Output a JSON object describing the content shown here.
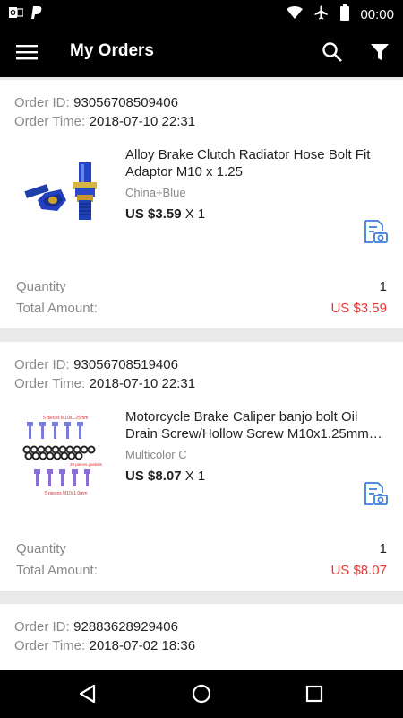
{
  "status_bar": {
    "time": "00:00",
    "left_icons": [
      "outlook-icon",
      "paypal-icon"
    ],
    "right_icons": [
      "wifi-icon",
      "airplane-mode-icon",
      "battery-icon"
    ]
  },
  "app_bar": {
    "title": "My Orders",
    "icons": [
      "menu-icon",
      "search-icon",
      "filter-icon"
    ]
  },
  "labels": {
    "order_id": "Order ID:",
    "order_time": "Order Time:",
    "quantity": "Quantity",
    "total_amount": "Total Amount:"
  },
  "orders": [
    {
      "order_id": "93056708509406",
      "order_time": "2018-07-10 22:31",
      "product_title": "Alloy Brake Clutch Radiator Hose Bolt Fit Adaptor M10 x 1.25",
      "variant": "China+Blue",
      "price": "US $3.59",
      "qty_text": " X 1",
      "quantity": "1",
      "total": "US $3.59"
    },
    {
      "order_id": "93056708519406",
      "order_time": "2018-07-10 22:31",
      "product_title": "Motorcycle Brake Caliper banjo bolt Oil Drain Screw/Hollow Screw M10x1.25mm…",
      "variant": "Multicolor C",
      "price": "US $8.07",
      "qty_text": " X 1",
      "quantity": "1",
      "total": "US $8.07",
      "image_captions": [
        "5 pieces M10x1.25mm",
        "20 pieces gaskets",
        "5 pieces M10x1.0mm"
      ]
    },
    {
      "order_id": "92883628929406",
      "order_time": "2018-07-02 18:36"
    }
  ],
  "colors": {
    "accent_red": "#e53935",
    "icon_blue": "#3d7fd6",
    "bar_black": "#000000"
  },
  "nav_bar": {
    "icons": [
      "back-icon",
      "home-icon",
      "recents-icon"
    ]
  }
}
